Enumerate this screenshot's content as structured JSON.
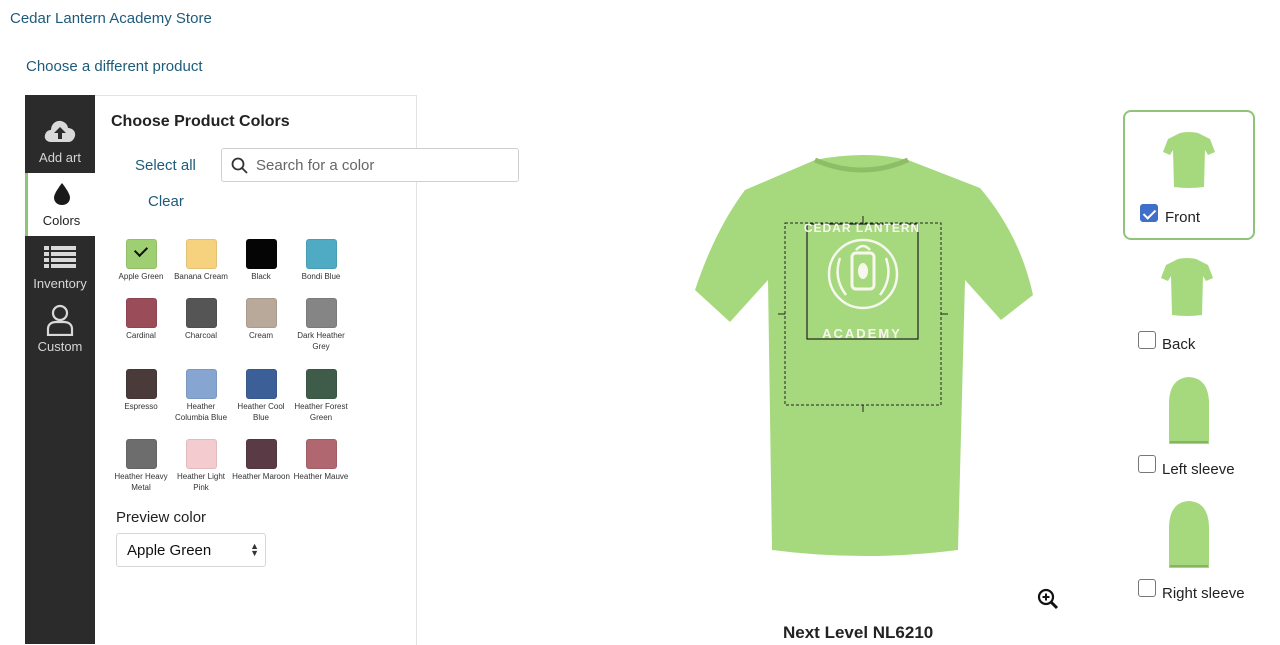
{
  "store_title": "Cedar Lantern Academy Store",
  "choose_product_link": "Choose a different product",
  "sidebar": {
    "tabs": [
      {
        "label": "Add art",
        "icon": "cloud-upload-icon"
      },
      {
        "label": "Colors",
        "icon": "droplet-icon",
        "active": true
      },
      {
        "label": "Inventory",
        "icon": "list-icon"
      },
      {
        "label": "Custom",
        "icon": "user-icon"
      }
    ]
  },
  "panel": {
    "title": "Choose Product Colors",
    "select_all": "Select all",
    "clear": "Clear",
    "search_placeholder": "Search for a color"
  },
  "colors": [
    {
      "name": "Apple Green",
      "hex": "#9fcf73",
      "selected": true
    },
    {
      "name": "Banana Cream",
      "hex": "#f7d27e"
    },
    {
      "name": "Black",
      "hex": "#050505"
    },
    {
      "name": "Bondi Blue",
      "hex": "#4faac3"
    },
    {
      "name": "Cardinal",
      "hex": "#9a4c58"
    },
    {
      "name": "Charcoal",
      "hex": "#555555"
    },
    {
      "name": "Cream",
      "hex": "#b8a99b"
    },
    {
      "name": "Dark Heather Grey",
      "hex": "#858585"
    },
    {
      "name": "Espresso",
      "hex": "#4a3a3a"
    },
    {
      "name": "Heather Columbia Blue",
      "hex": "#86a6d1"
    },
    {
      "name": "Heather Cool Blue",
      "hex": "#3d5f98"
    },
    {
      "name": "Heather Forest Green",
      "hex": "#3e5c49"
    },
    {
      "name": "Heather Heavy Metal",
      "hex": "#6d6d6d"
    },
    {
      "name": "Heather Light Pink",
      "hex": "#f4ccd0"
    },
    {
      "name": "Heather Maroon",
      "hex": "#5a3a45"
    },
    {
      "name": "Heather Mauve",
      "hex": "#b0676f"
    }
  ],
  "preview": {
    "label": "Preview color",
    "value": "Apple Green"
  },
  "shirt": {
    "color": "#a6d97e",
    "design_top_text": "CEDAR LANTERN",
    "design_bottom_text": "ACADEMY"
  },
  "product_name": "Next Level NL6210",
  "views": [
    {
      "label": "Front",
      "checked": true
    },
    {
      "label": "Back",
      "checked": false
    },
    {
      "label": "Left sleeve",
      "checked": false
    },
    {
      "label": "Right sleeve",
      "checked": false
    }
  ]
}
